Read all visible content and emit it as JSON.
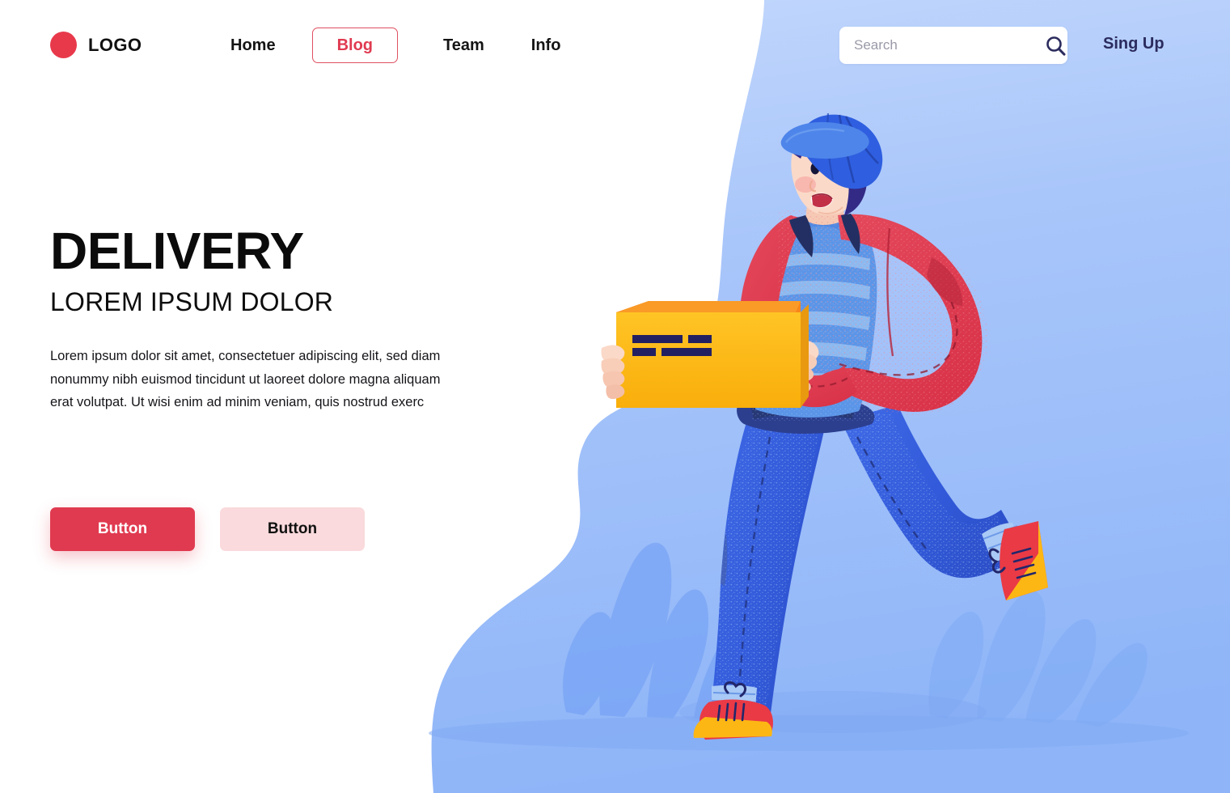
{
  "header": {
    "logo_text": "LOGO",
    "logo_color": "#e8394b",
    "nav": [
      {
        "label": "Home",
        "active": false
      },
      {
        "label": "Blog",
        "active": true
      },
      {
        "label": "Team",
        "active": false
      },
      {
        "label": "Info",
        "active": false
      }
    ],
    "search": {
      "value": "",
      "placeholder": "Search",
      "icon": "search-icon"
    },
    "signup_label": "Sing Up"
  },
  "hero": {
    "title": "DELIVERY",
    "subtitle": "LOREM IPSUM DOLOR",
    "paragraph": "Lorem ipsum dolor sit amet, consectetuer adipiscing elit, sed diam nonummy nibh euismod tincidunt ut laoreet dolore magna aliquam erat volutpat. Ut wisi enim ad minim veniam, quis nostrud exerc",
    "primary_button": "Button",
    "secondary_button": "Button"
  },
  "illustration": {
    "description": "Delivery courier running while carrying a cardboard box",
    "elements": [
      "background-blob",
      "bush-left",
      "bush-right",
      "ground-shadow",
      "courier-character",
      "cardboard-box"
    ]
  },
  "colors": {
    "accent_red": "#e03a50",
    "accent_red_soft": "#fadadc",
    "navy": "#2b2b5e",
    "blob_blue": "#9dbdf9",
    "bush_blue": "#7aa6f5",
    "jacket_red": "#e04156",
    "box_yellow": "#fdb714",
    "box_orange": "#f7861b",
    "jeans_blue": "#3a62e0",
    "shirt_blue": "#5b95e8",
    "skin": "#fbd9c8",
    "text_dark": "#111111"
  }
}
